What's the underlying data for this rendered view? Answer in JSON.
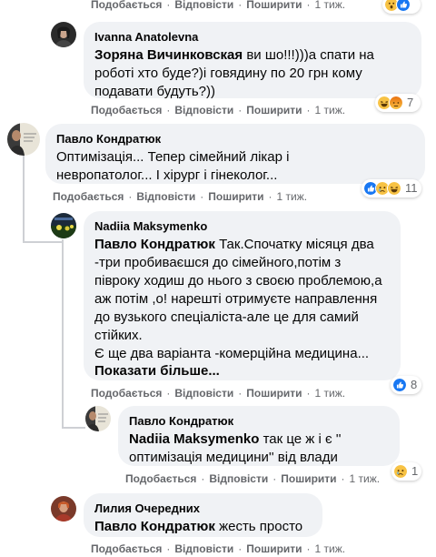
{
  "actions": {
    "like": "Подобається",
    "reply": "Відповісти",
    "share": "Поширити",
    "time": "1 тиж."
  },
  "comments": [
    {
      "author": "Ivanna Anatolevna",
      "mention": "Зоряна Вичинковская",
      "text_lines": [
        "ви шо!!!)))а спати на",
        "роботі хто буде?)і говядину по 20 грн кому",
        "подавати будуть?))"
      ],
      "reactions": [
        "haha",
        "angry"
      ],
      "reaction_count": "7"
    },
    {
      "author": "Павло Кондратюк",
      "text_lines": [
        "Оптимізація... Тепер сімейний лікар і",
        "невропатолог... І хірург і гінеколог..."
      ],
      "reactions": [
        "like",
        "sad",
        "haha"
      ],
      "reaction_count": "11"
    },
    {
      "author": "Nadiia Maksymenko",
      "mention": "Павло Кондратюк",
      "text_lines": [
        "Так.Спочатку місяця два",
        "-три пробиваєшся до сімейного,потім з",
        "півроку ходиш до нього з своєю проблемою,а",
        "аж потім ,о! нарешті отримуєте направлення",
        "до вузького спеціаліста-але це для самий",
        "стійких.",
        "Є ще два варіанта -комерційна медицина..."
      ],
      "see_more": "Показати більше...",
      "reactions": [
        "like"
      ],
      "reaction_count": "8"
    },
    {
      "author": "Павло Кондратюк",
      "mention": "Nadiia Maksymenko",
      "text_lines": [
        "так це ж і є ''",
        "оптимізація медицини'' від влади"
      ],
      "reactions": [
        "sad"
      ],
      "reaction_count": "1"
    },
    {
      "author": "Лилия Очередних",
      "mention": "Павло Кондратюк",
      "text_lines": [
        "жесть просто"
      ]
    }
  ],
  "colors": {
    "bubble": "#f0f2f5",
    "secondary_text": "#65676b",
    "like_blue": "#1877f2",
    "reaction_yellow": "#f7c244",
    "angry_orange": "#e9710f"
  }
}
